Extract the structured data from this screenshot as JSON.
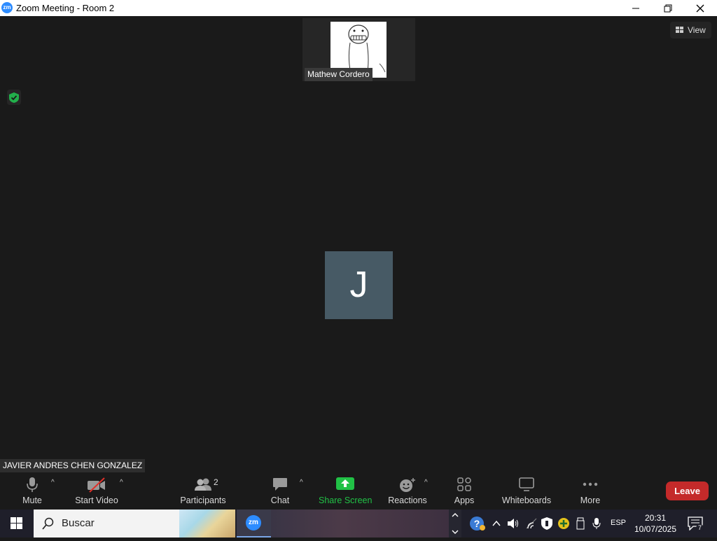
{
  "window": {
    "app_logo": "zm",
    "title": "Zoom Meeting - Room 2"
  },
  "meeting": {
    "thumbnail_name": "Mathew Cordero",
    "view_label": "View",
    "avatar_initial": "J",
    "self_name": "JAVIER ANDRES CHEN GONZALEZ"
  },
  "toolbar": {
    "mute_label": "Mute",
    "start_video_label": "Start Video",
    "participants_label": "Participants",
    "participants_count": "2",
    "chat_label": "Chat",
    "share_screen_label": "Share Screen",
    "reactions_label": "Reactions",
    "apps_label": "Apps",
    "whiteboards_label": "Whiteboards",
    "more_label": "More",
    "leave_label": "Leave"
  },
  "taskbar": {
    "search_text": "Buscar",
    "zoom_label": "zm",
    "language": "ESP",
    "time": "20:31",
    "date": "10/07/2025",
    "notification_count": "7"
  },
  "colors": {
    "background": "#1a1a1a",
    "accent_blue": "#2d8cff",
    "share_green": "#21c146",
    "leave_red": "#c42a2a",
    "avatar_bg": "#475a65",
    "shield_green": "#22b04b"
  }
}
